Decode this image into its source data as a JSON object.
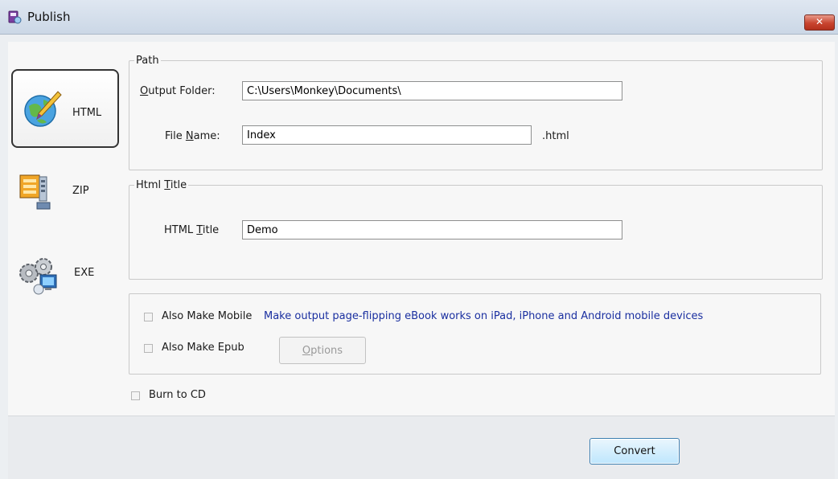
{
  "window": {
    "title": "Publish",
    "close_glyph": "✕"
  },
  "nav": {
    "items": [
      {
        "label": "HTML",
        "icon": "globe-pen-icon",
        "selected": true
      },
      {
        "label": "ZIP",
        "icon": "zip-archive-icon",
        "selected": false
      },
      {
        "label": "EXE",
        "icon": "gears-computer-icon",
        "selected": false
      }
    ]
  },
  "path_group": {
    "legend": "Path",
    "output_folder": {
      "label_pre": "",
      "label_u": "O",
      "label_post": "utput Folder:",
      "value": "C:\\Users\\Monkey\\Documents\\"
    },
    "file_name": {
      "label_pre": "File ",
      "label_u": "N",
      "label_post": "ame:",
      "value": "Index",
      "suffix": ".html"
    }
  },
  "title_group": {
    "legend_pre": "Html ",
    "legend_u": "T",
    "legend_post": "itle",
    "html_title": {
      "label_pre": "HTML ",
      "label_u": "T",
      "label_post": "itle",
      "value": "Demo"
    }
  },
  "options_group": {
    "also_make_mobile": {
      "label": "Also Make Mobile",
      "checked": false,
      "note": "Make output page-flipping eBook works on iPad, iPhone and Android mobile devices"
    },
    "also_make_epub": {
      "label": "Also Make Epub",
      "checked": false
    },
    "options_button": {
      "label_u": "O",
      "label_post": "ptions"
    }
  },
  "burn_to_cd": {
    "label": "Burn to CD",
    "checked": false
  },
  "convert_button": {
    "label": "Convert"
  },
  "colors": {
    "note_blue": "#1a2fa0",
    "convert_border": "#3c7fb1"
  }
}
